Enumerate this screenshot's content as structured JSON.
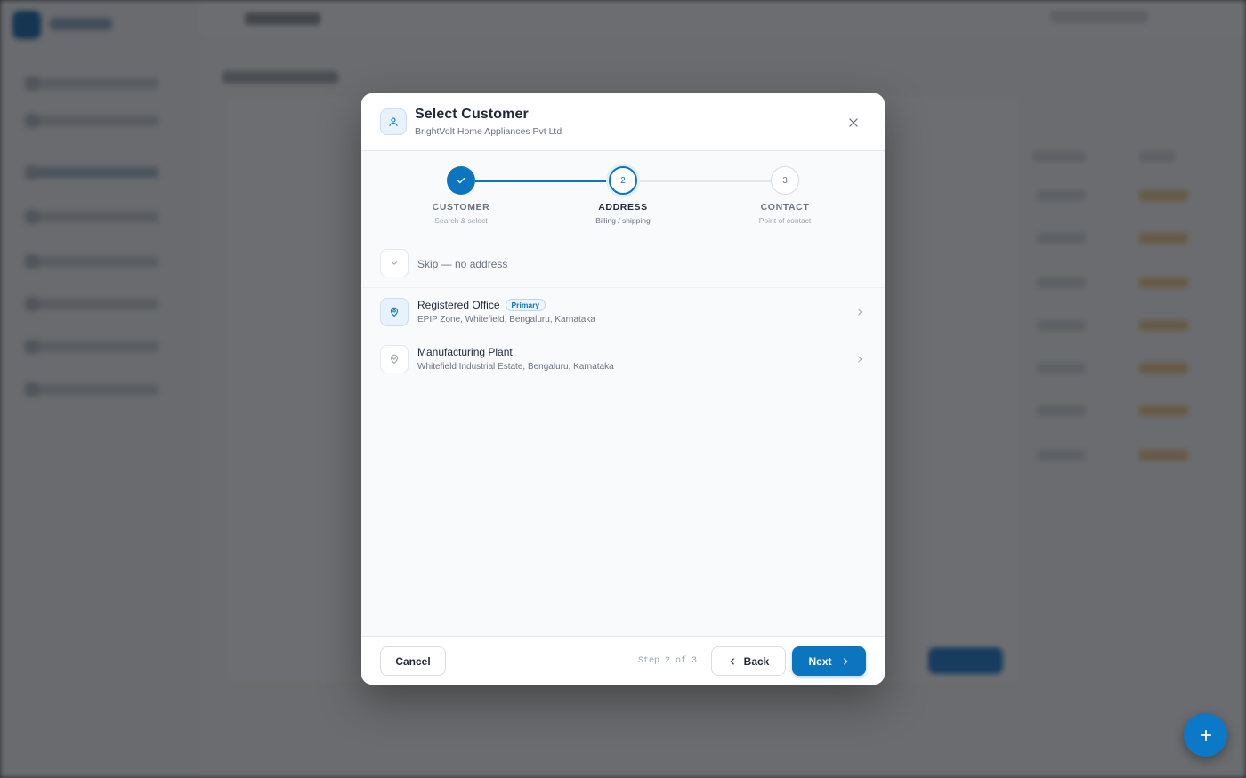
{
  "modal": {
    "title": "Select Customer",
    "subtitle": "BrightVolt Home Appliances Pvt Ltd",
    "header_icon": "user-icon",
    "close_icon": "close-icon"
  },
  "stepper": {
    "current_step": 2,
    "total_steps": 3,
    "steps": [
      {
        "number": "1",
        "label": "CUSTOMER",
        "sublabel": "Search & select",
        "state": "done"
      },
      {
        "number": "2",
        "label": "ADDRESS",
        "sublabel": "Billing / shipping",
        "state": "active"
      },
      {
        "number": "3",
        "label": "CONTACT",
        "sublabel": "Point of contact",
        "state": "todo"
      }
    ]
  },
  "address_options": {
    "skip_label": "Skip — no address",
    "skip_icon": "chevron-down-icon",
    "items": [
      {
        "name": "Registered Office",
        "badge": "Primary",
        "address": "EPIP Zone, Whitefield, Bengaluru, Karnataka",
        "icon": "map-pin-icon"
      },
      {
        "name": "Manufacturing Plant",
        "badge": "",
        "address": "Whitefield Industrial Estate, Bengaluru, Karnataka",
        "icon": "map-pin-icon"
      }
    ]
  },
  "footer": {
    "cancel_label": "Cancel",
    "step_indicator": "Step 2 of 3",
    "back_label": "Back",
    "next_label": "Next"
  },
  "colors": {
    "accent": "#0b75c0",
    "badge_bg": "#eef6fd",
    "overlay": "#16181c"
  },
  "fab": {
    "icon": "plus-icon"
  }
}
